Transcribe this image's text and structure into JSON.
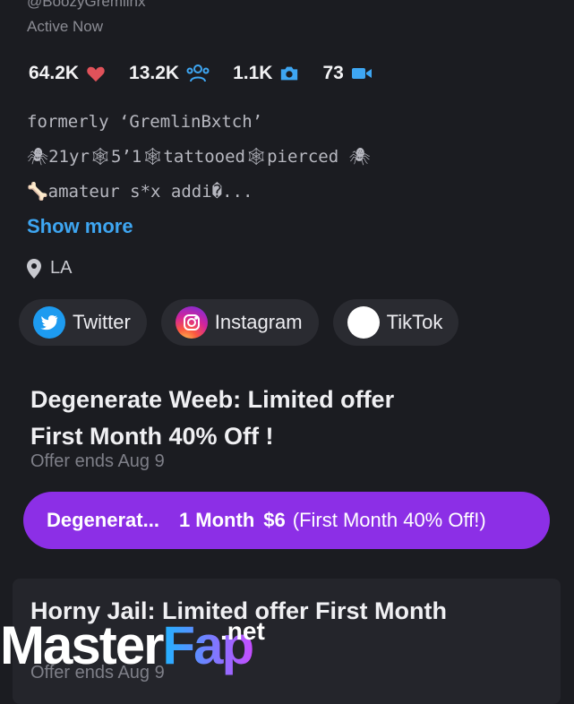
{
  "profile": {
    "handle": "@BoozyGremlinx",
    "status": "Active Now",
    "location": "LA"
  },
  "stats": [
    {
      "value": "64.2K",
      "icon": "heart-icon"
    },
    {
      "value": "13.2K",
      "icon": "people-icon"
    },
    {
      "value": "1.1K",
      "icon": "camera-icon"
    },
    {
      "value": "73",
      "icon": "video-icon"
    }
  ],
  "bio": {
    "line1": "formerly ‘GremlinBxtch’",
    "line2": "🕷21yr🕸5’1🕸tattooed🕸pierced 🕷",
    "line3": "🦴amateur s*x addi�...",
    "show_more": "Show more"
  },
  "socials": [
    {
      "label": "Twitter",
      "icon": "twitter-icon"
    },
    {
      "label": "Instagram",
      "icon": "instagram-icon"
    },
    {
      "label": "TikTok",
      "icon": "tiktok-icon"
    }
  ],
  "offer1": {
    "title_line1": "Degenerate Weeb: Limited offer",
    "title_line2": "First Month 40% Off !",
    "ends": "Offer ends Aug 9",
    "button": {
      "name": "Degenerat...",
      "months": "1 Month",
      "price": "$6",
      "note": "(First Month 40% Off!)"
    }
  },
  "offer2": {
    "title": "Horny Jail: Limited offer First Month",
    "ends": "Offer ends Aug 9"
  },
  "watermark": {
    "part1": "Master",
    "part2": "Fap",
    "suffix": ".net"
  },
  "colors": {
    "background": "#1b1c21",
    "accent": "#8c2fe6",
    "link": "#3ea6f2",
    "heart": "#e0525a"
  }
}
